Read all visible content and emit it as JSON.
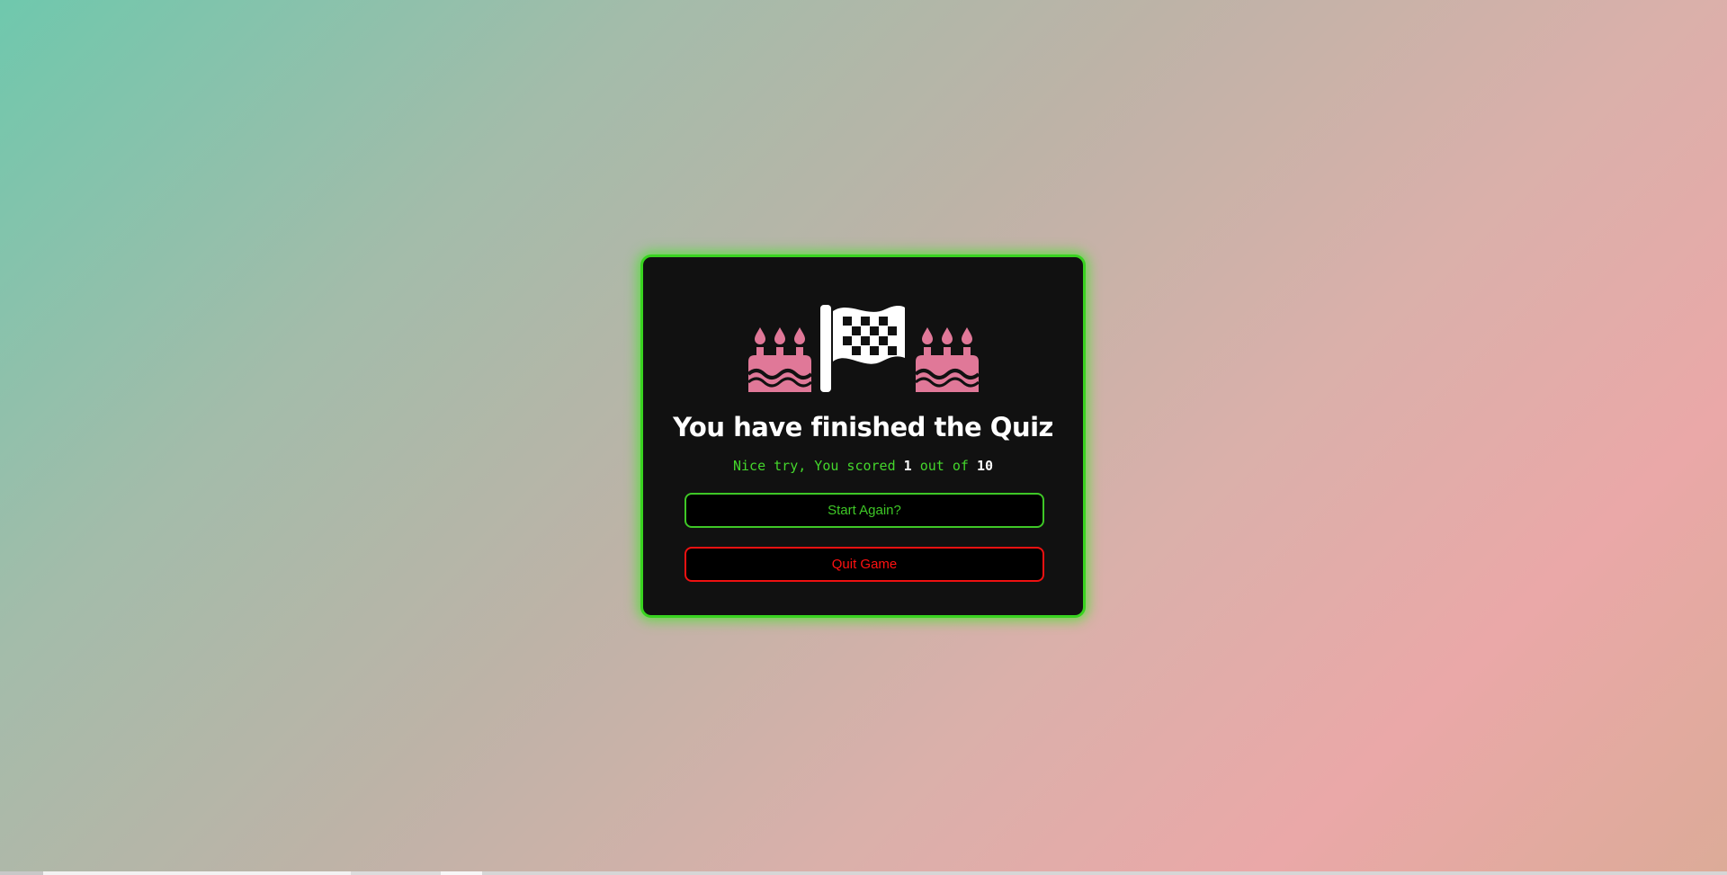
{
  "colors": {
    "card_border": "#39d320",
    "card_background": "#111111",
    "cake": "#e07898",
    "flag": "#ffffff",
    "score_text": "#44d62c",
    "start_button": "#3ec726",
    "quit_button": "#ff1111"
  },
  "result": {
    "icons": [
      "birthday-cake-icon",
      "checkered-flag-icon",
      "birthday-cake-icon"
    ],
    "title": "You have finished the Quiz",
    "score_prefix": "Nice try, You scored",
    "score_value": "1",
    "score_middle": "out of",
    "score_total": "10"
  },
  "buttons": {
    "start_label": "Start Again?",
    "quit_label": "Quit Game"
  }
}
